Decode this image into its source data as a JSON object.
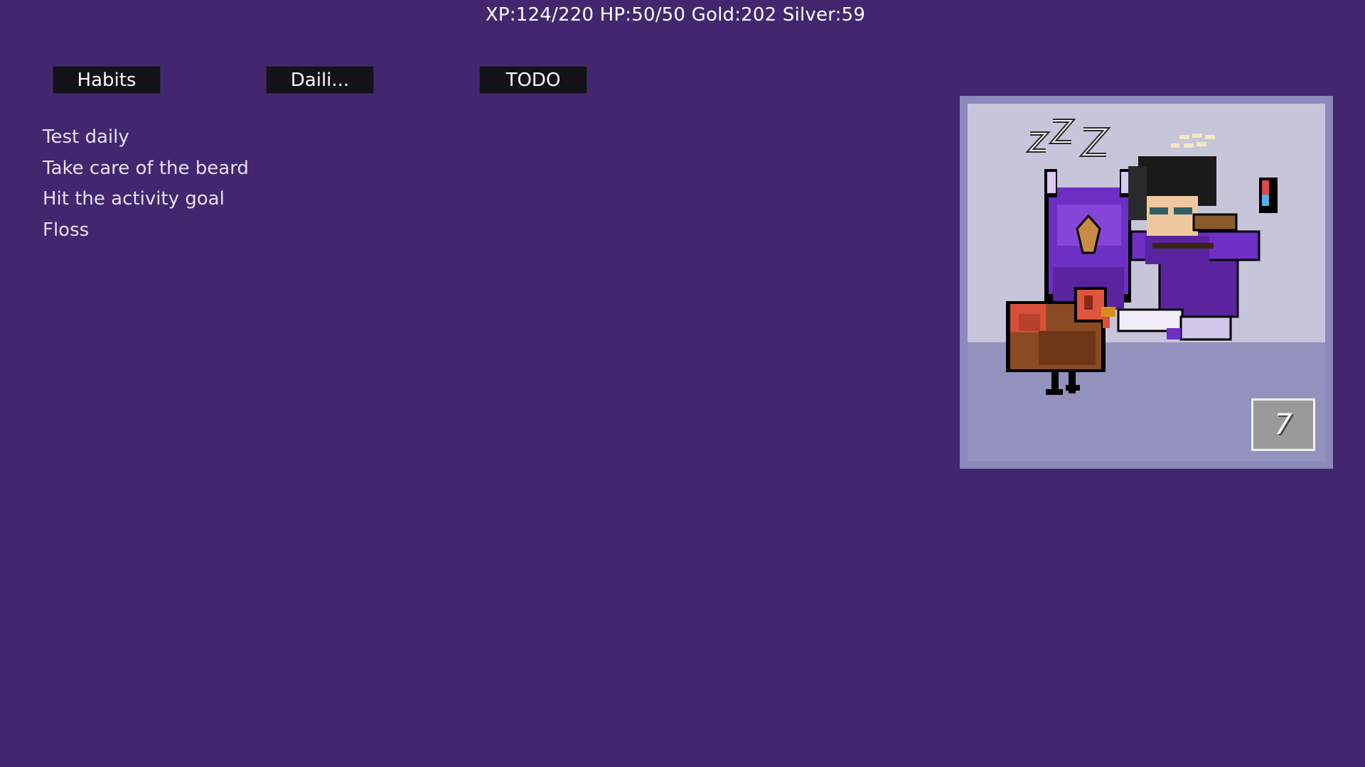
{
  "status": {
    "text": "XP:124/220 HP:50/50 Gold:202 Silver:59"
  },
  "tabs": [
    {
      "label": "Habits"
    },
    {
      "label": "Daili..."
    },
    {
      "label": "TODO"
    }
  ],
  "tasks": [
    {
      "label": "Test daily"
    },
    {
      "label": "Take care of the beard"
    },
    {
      "label": "Hit the activity goal"
    },
    {
      "label": "Floss"
    }
  ],
  "avatar": {
    "level": "7",
    "sleep_text": "zZZ",
    "state": "sleeping",
    "pet": "turkey",
    "mount": "purple-owl"
  },
  "colors": {
    "background": "#42276f",
    "tab_background": "#121218",
    "avatar_sky": "#c7c5da",
    "avatar_ground": "#9391bd"
  }
}
